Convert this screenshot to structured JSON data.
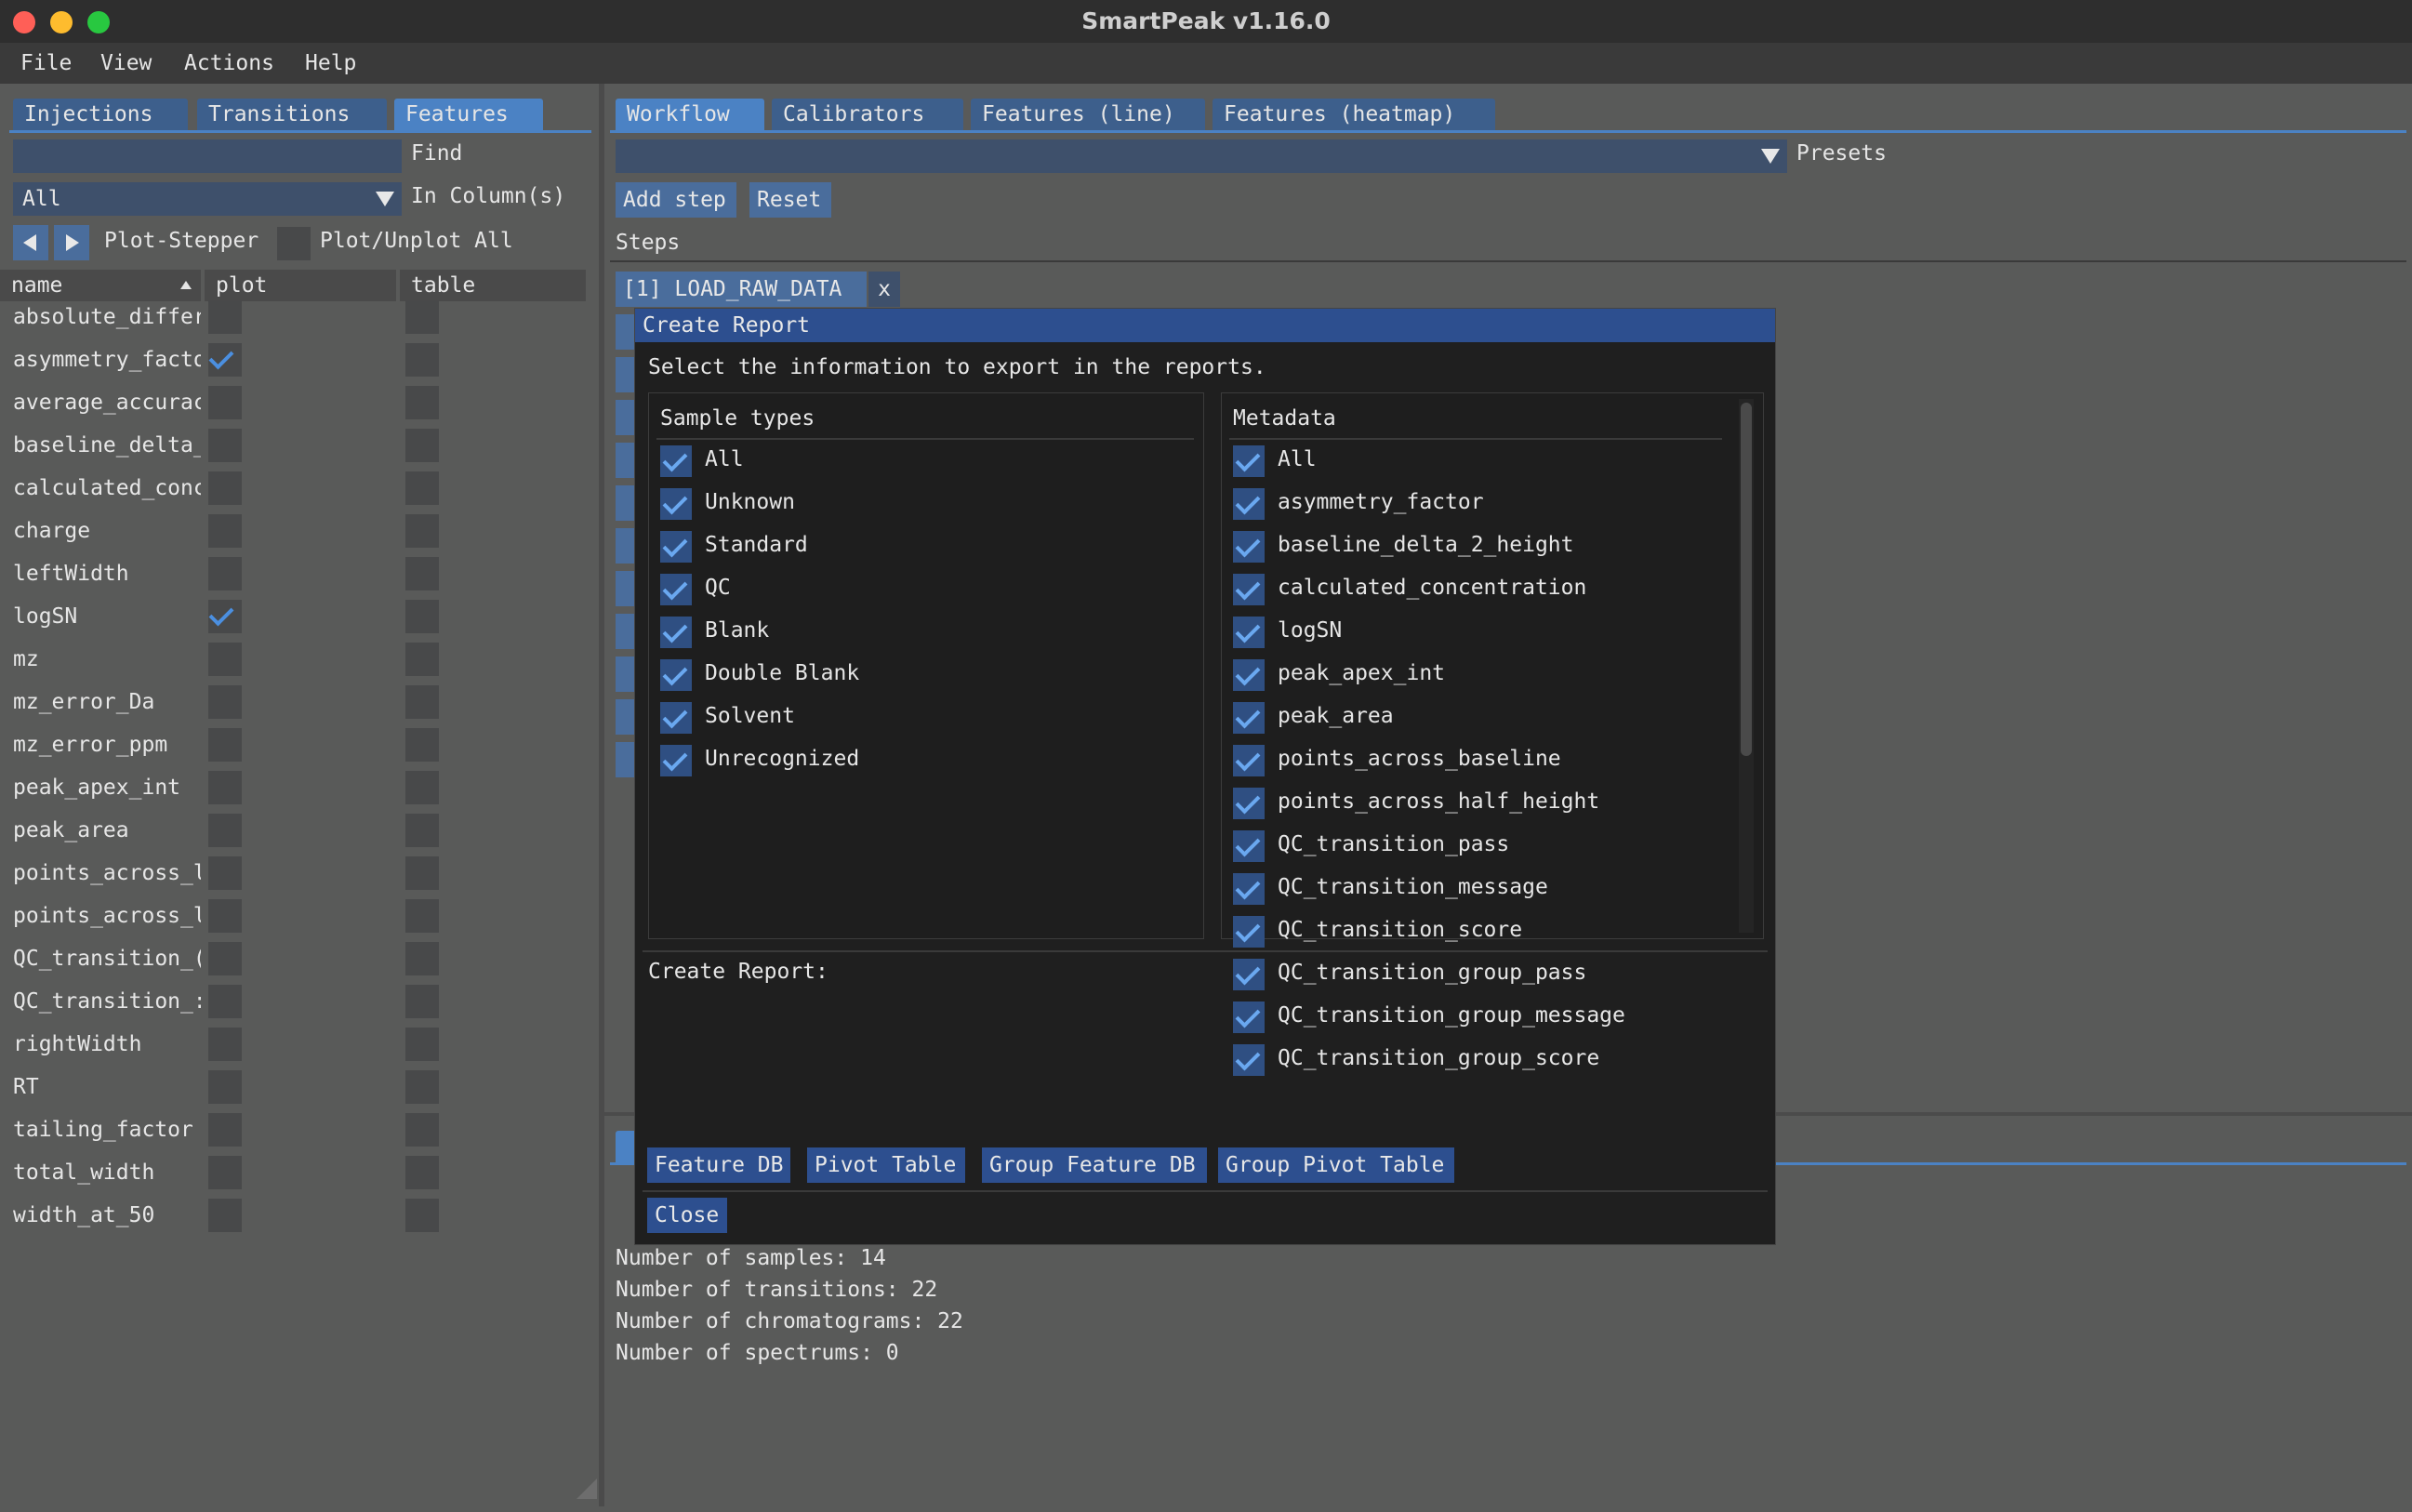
{
  "window": {
    "title": "SmartPeak v1.16.0"
  },
  "menu": [
    "File",
    "View",
    "Actions",
    "Help"
  ],
  "left": {
    "tabs": [
      "Injections",
      "Transitions",
      "Features"
    ],
    "find_label": "Find",
    "column_filter_value": "All",
    "in_columns_label": "In Column(s)",
    "plot_stepper_label": "Plot-Stepper",
    "plot_unplot_label": "Plot/Unplot All",
    "headers": [
      "name",
      "plot",
      "table"
    ],
    "rows": [
      {
        "name": "absolute_differ",
        "plot": false
      },
      {
        "name": "asymmetry_facto",
        "plot": true
      },
      {
        "name": "average_accurac",
        "plot": false
      },
      {
        "name": "baseline_delta_",
        "plot": false
      },
      {
        "name": "calculated_conc",
        "plot": false
      },
      {
        "name": "charge",
        "plot": false
      },
      {
        "name": "leftWidth",
        "plot": false
      },
      {
        "name": "logSN",
        "plot": true
      },
      {
        "name": "mz",
        "plot": false
      },
      {
        "name": "mz_error_Da",
        "plot": false
      },
      {
        "name": "mz_error_ppm",
        "plot": false
      },
      {
        "name": "peak_apex_int",
        "plot": false
      },
      {
        "name": "peak_area",
        "plot": false
      },
      {
        "name": "points_across_l",
        "plot": false
      },
      {
        "name": "points_across_l",
        "plot": false
      },
      {
        "name": "QC_transition_(",
        "plot": false
      },
      {
        "name": "QC_transition_:",
        "plot": false
      },
      {
        "name": "rightWidth",
        "plot": false
      },
      {
        "name": "RT",
        "plot": false
      },
      {
        "name": "tailing_factor",
        "plot": false
      },
      {
        "name": "total_width",
        "plot": false
      },
      {
        "name": "width_at_50",
        "plot": false
      }
    ]
  },
  "right": {
    "tabs": [
      "Workflow",
      "Calibrators",
      "Features (line)",
      "Features (heatmap)"
    ],
    "presets_label": "Presets",
    "add_step_label": "Add step",
    "reset_label": "Reset",
    "steps_label": "Steps",
    "first_step": "[1] LOAD_RAW_DATA",
    "remove_label": "x",
    "info_lines": [
      "Number of samples: 14",
      "Number of transitions: 22",
      "Number of chromatograms: 22",
      "Number of spectrums: 0"
    ]
  },
  "modal": {
    "title": "Create Report",
    "instruction": "Select the information to export in the reports.",
    "sample_types_header": "Sample types",
    "sample_types": [
      "All",
      "Unknown",
      "Standard",
      "QC",
      "Blank",
      "Double Blank",
      "Solvent",
      "Unrecognized"
    ],
    "metadata_header": "Metadata",
    "metadata": [
      "All",
      "asymmetry_factor",
      "baseline_delta_2_height",
      "calculated_concentration",
      "logSN",
      "peak_apex_int",
      "peak_area",
      "points_across_baseline",
      "points_across_half_height",
      "QC_transition_pass",
      "QC_transition_message",
      "QC_transition_score",
      "QC_transition_group_pass",
      "QC_transition_group_message",
      "QC_transition_group_score"
    ],
    "create_report_label": "Create Report:",
    "buttons": [
      "Feature DB",
      "Pivot Table",
      "Group Feature DB",
      "Group Pivot Table"
    ],
    "close_label": "Close"
  },
  "colors": {
    "accent": "#4b82c4",
    "modal_title": "#2d4f8f",
    "close_dot": "#ff5f57",
    "min_dot": "#febc2e",
    "max_dot": "#28c840"
  }
}
